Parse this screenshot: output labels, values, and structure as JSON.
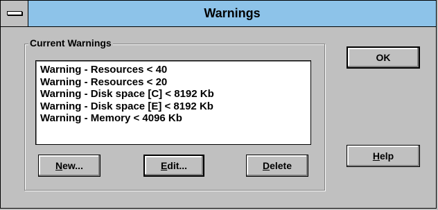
{
  "window": {
    "title": "Warnings"
  },
  "group": {
    "label": "Current Warnings"
  },
  "warnings": [
    "Warning - Resources < 40",
    "Warning - Resources < 20",
    "Warning - Disk space [C] < 8192 Kb",
    "Warning - Disk space [E] < 8192 Kb",
    "Warning - Memory < 4096 Kb"
  ],
  "buttons": {
    "new_hotkey": "N",
    "new_rest": "ew...",
    "edit_hotkey": "E",
    "edit_rest": "dit...",
    "delete_hotkey": "D",
    "delete_rest": "elete",
    "ok": "OK",
    "help_hotkey": "H",
    "help_rest": "elp"
  },
  "icons": {
    "system_menu": "system-menu-icon"
  }
}
